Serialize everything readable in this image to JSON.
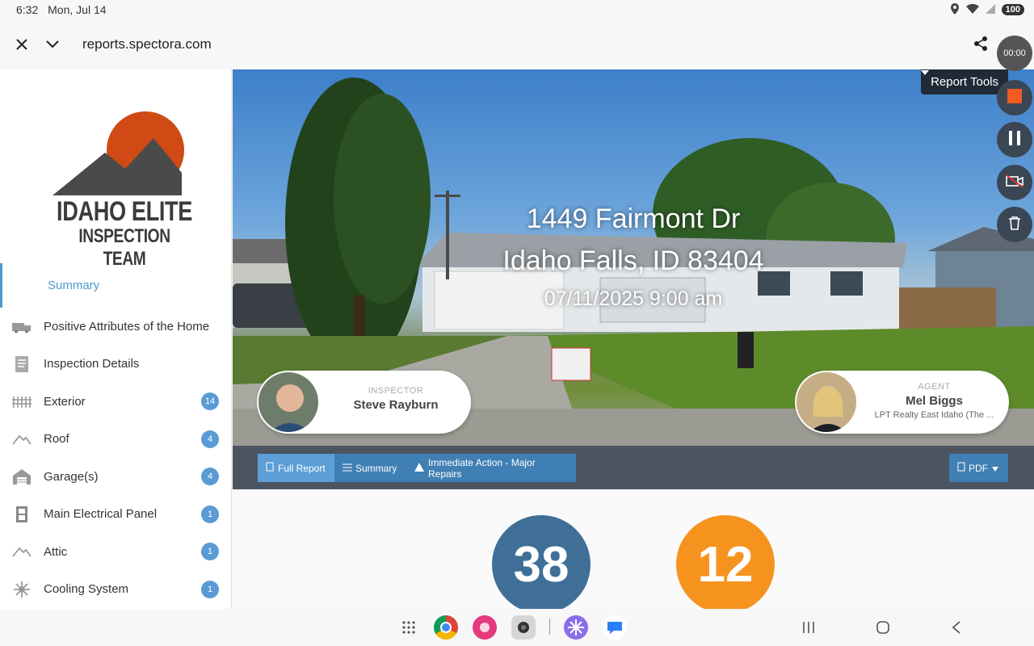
{
  "status": {
    "time": "6:32",
    "date": "Mon, Jul 14",
    "battery": "100"
  },
  "browser": {
    "url": "reports.spectora.com"
  },
  "recorder": {
    "timer": "00:00"
  },
  "logo": {
    "line1": "IDAHO ELITE",
    "line2": "INSPECTION TEAM"
  },
  "sidebar": {
    "summary": "Summary",
    "items": [
      {
        "label": "Positive Attributes of the Home",
        "icon": "house-truck-icon",
        "count": ""
      },
      {
        "label": "Inspection Details",
        "icon": "document-icon",
        "count": ""
      },
      {
        "label": "Exterior",
        "icon": "fence-icon",
        "count": "14"
      },
      {
        "label": "Roof",
        "icon": "roof-icon",
        "count": "4"
      },
      {
        "label": "Garage(s)",
        "icon": "garage-icon",
        "count": "4"
      },
      {
        "label": "Main Electrical Panel",
        "icon": "electrical-panel-icon",
        "count": "1"
      },
      {
        "label": "Attic",
        "icon": "attic-icon",
        "count": "1"
      },
      {
        "label": "Cooling System",
        "icon": "snowflake-icon",
        "count": "1"
      }
    ]
  },
  "hero": {
    "address1": "1449 Fairmont Dr",
    "address2": "Idaho Falls, ID 83404",
    "datetime": "07/11/2025 9:00 am",
    "report_tools": "Report Tools"
  },
  "inspector": {
    "role": "INSPECTOR",
    "name": "Steve Rayburn"
  },
  "agent": {
    "role": "AGENT",
    "name": "Mel Biggs",
    "company": "LPT Realty East Idaho (The ..."
  },
  "toolbar": {
    "full_report": "Full Report",
    "summary": "Summary",
    "immediate": "Immediate Action - Major Repairs",
    "pdf": "PDF"
  },
  "counts": {
    "blue": "38",
    "orange": "12"
  },
  "colors": {
    "accent": "#5b9bd5",
    "circle_blue": "#3f6f97",
    "circle_orange": "#f6931e",
    "toolbar": "#4a5560"
  }
}
